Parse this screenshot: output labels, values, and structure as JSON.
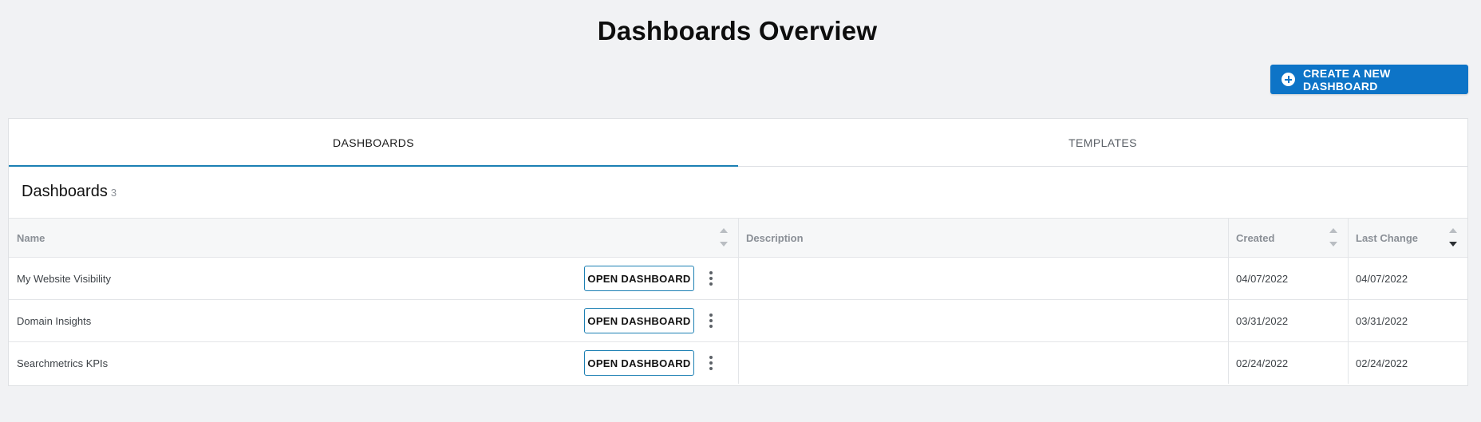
{
  "page": {
    "title": "Dashboards Overview"
  },
  "actions": {
    "create_label": "CREATE A NEW DASHBOARD"
  },
  "tabs": [
    {
      "label": "DASHBOARDS",
      "active": true
    },
    {
      "label": "TEMPLATES",
      "active": false
    }
  ],
  "section": {
    "title": "Dashboards",
    "count": "3"
  },
  "table": {
    "columns": {
      "name": "Name",
      "description": "Description",
      "created": "Created",
      "last_change": "Last Change"
    },
    "sort": {
      "column": "last_change",
      "direction": "desc"
    },
    "open_label": "OPEN DASHBOARD",
    "rows": [
      {
        "name": "My Website Visibility",
        "description": "",
        "created": "04/07/2022",
        "last_change": "04/07/2022"
      },
      {
        "name": "Domain Insights",
        "description": "",
        "created": "03/31/2022",
        "last_change": "03/31/2022"
      },
      {
        "name": "Searchmetrics KPIs",
        "description": "",
        "created": "02/24/2022",
        "last_change": "02/24/2022"
      }
    ]
  },
  "colors": {
    "accent": "#0d74c7",
    "tab_indicator": "#1b7fb3",
    "background": "#f1f2f4"
  },
  "icons": {
    "create": "plus-circle-icon",
    "row_menu": "kebab-menu-icon",
    "sort": "sort-arrows-icon"
  }
}
